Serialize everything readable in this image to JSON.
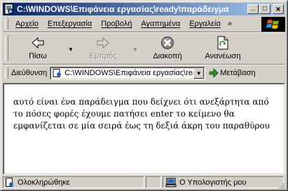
{
  "window": {
    "title": "C:\\WINDOWS\\Επιφάνεια εργασίας\\ready\\παράδειγμα",
    "buttons": {
      "minimize": "_",
      "maximize": "□",
      "close": "×"
    }
  },
  "menu": {
    "items": [
      "Αρχείο",
      "Επεξεργασία",
      "Προβολή",
      "Αγαπημένα",
      "Εργαλεία"
    ],
    "overflow": "»"
  },
  "toolbar": {
    "back": "Πίσω",
    "forward": "Εμπρός",
    "stop": "Διακοπή",
    "refresh": "Ανανέωση",
    "dropdown_arrow": "▼"
  },
  "address": {
    "label": "Διεύθυνση",
    "value": "C:\\WINDOWS\\Επιφάνεια εργασίας\\ready\\παράδειγμα.html",
    "dropdown_arrow": "▼",
    "go": "Μετάβαση"
  },
  "content": {
    "text": "αυτό είναι ένα παράδειγμα που δείχνει ότι ανεξάρτητα από το πόσες φορές έχουμε πατήσει enter το κείμενο θα εμφανίζεται σε μία σειρά έως τη δεξιά άκρη του παραθύρου"
  },
  "status": {
    "left": "Ολοκληρώθηκε",
    "zone": "Ο Υπολογιστής μου"
  },
  "colors": {
    "title_start": "#0a246a",
    "title_end": "#a6caf0",
    "face": "#d4d0c8"
  },
  "icons": {
    "title": "ie-page-icon",
    "back": "arrow-left-icon",
    "forward": "arrow-right-icon",
    "stop": "stop-icon",
    "refresh": "refresh-icon",
    "go": "go-arrow-icon",
    "zone": "computer-icon",
    "windows": "windows-logo-icon"
  }
}
